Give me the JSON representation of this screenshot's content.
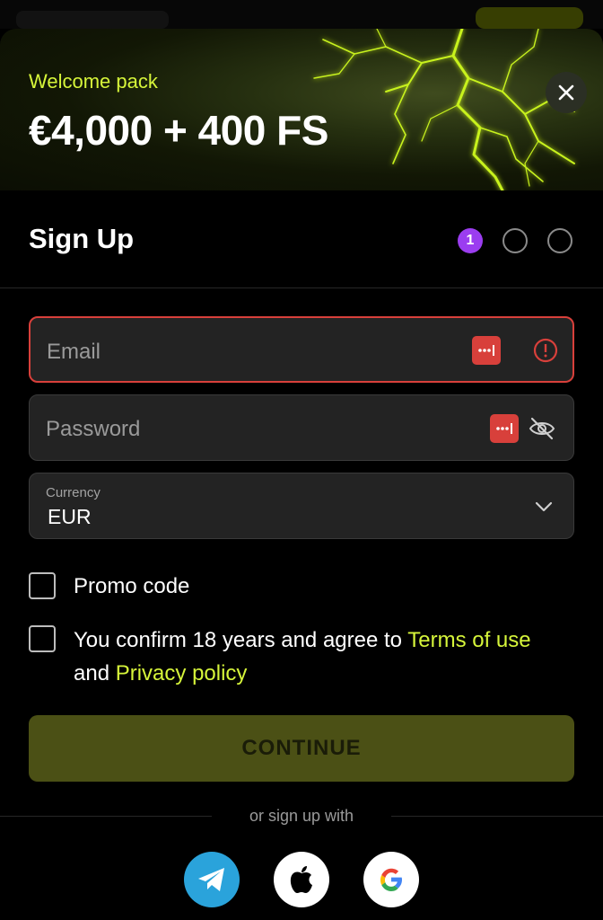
{
  "banner": {
    "welcome": "Welcome pack",
    "amount": "€4,000 + 400 FS"
  },
  "header": {
    "title": "Sign Up",
    "steps": [
      "1",
      "",
      ""
    ]
  },
  "form": {
    "email_placeholder": "Email",
    "password_placeholder": "Password",
    "currency_label": "Currency",
    "currency_value": "EUR",
    "promo_label": "Promo code",
    "terms_prefix": "You confirm 18 years and agree to ",
    "terms_link": "Terms of use",
    "terms_and": "and ",
    "privacy_link": "Privacy policy"
  },
  "actions": {
    "continue": "CONTINUE",
    "or_sign_up": "or sign up with"
  },
  "social": [
    "telegram-icon",
    "apple-icon",
    "google-icon"
  ],
  "colors": {
    "accent": "#d6f53a",
    "step_active": "#9b3df0",
    "error": "#d8403b",
    "continue_bg": "#4b5015",
    "telegram": "#2aa3db"
  },
  "icons": {
    "close": "close-icon",
    "password_manager": "password-manager-icon",
    "error": "error-icon",
    "eye_off": "eye-off-icon",
    "chevron": "chevron-down-icon"
  }
}
